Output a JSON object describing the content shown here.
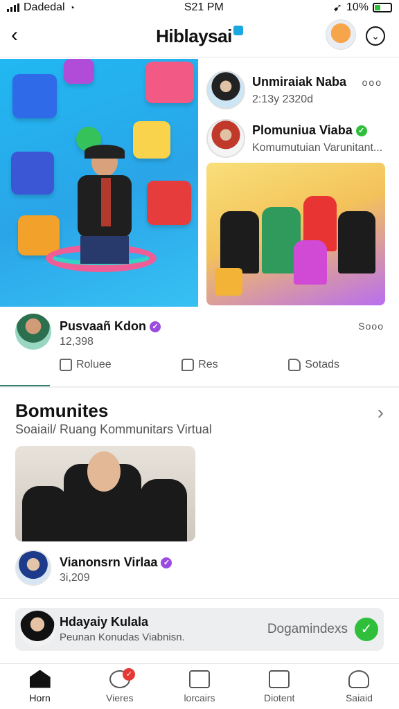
{
  "status_bar": {
    "carrier": "Dadedal",
    "time": "S21 PM",
    "battery": "10%"
  },
  "header": {
    "title": "Hiblaysai"
  },
  "feed": {
    "right_items": [
      {
        "name": "Unmiraiak Naba",
        "sub": "2:13y 2320d"
      },
      {
        "name": "Plomuniua Viaba",
        "sub": "Komumutuian Varunitant..."
      }
    ],
    "right_more": "ooo",
    "post": {
      "name": "Pusvaañ Kdon",
      "count": "12,398",
      "more": "Sooo"
    },
    "actions": {
      "like": "Roluee",
      "comment": "Res",
      "share": "Sotads"
    }
  },
  "section": {
    "title": "Bomunites",
    "subtitle": "Soaiail/ Ruang Kommunitars Virtual",
    "community": {
      "name": "Vianonsrn Virlaa",
      "count": "3i,209"
    }
  },
  "notification": {
    "name": "Hdayaiy Kulala",
    "sub": "Peunan Konudas Viabnisn.",
    "status": "Dogamindexs"
  },
  "tabbar": [
    {
      "label": "Horn"
    },
    {
      "label": "Vieres"
    },
    {
      "label": "lorcairs"
    },
    {
      "label": "Diotent"
    },
    {
      "label": "Saiaid"
    }
  ],
  "icons": {
    "back": "chevron-left-icon",
    "dropdown": "chevron-down-icon",
    "verified": "check-badge-icon",
    "more": "ellipsis-icon"
  }
}
